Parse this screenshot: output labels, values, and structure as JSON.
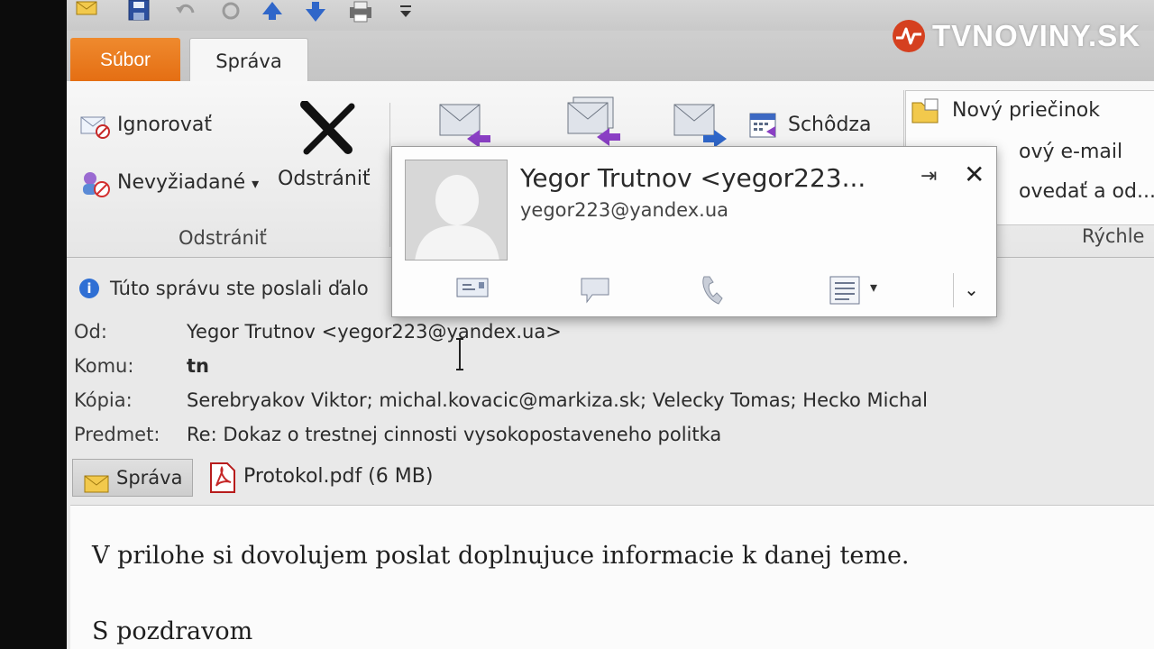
{
  "tabs": {
    "file": "Súbor",
    "message": "Správa"
  },
  "ribbon": {
    "ignore": "Ignorovať",
    "junk": "Nevyžiadané",
    "junk_arrow": "▾",
    "delete": "Odstrániť",
    "delete_group": "Odstrániť",
    "meeting": "Schôdza",
    "new_folder": "Nový priečinok",
    "new_email_partial": "ový e-mail",
    "reply_delete_partial": "ovedať a od...",
    "quick_steps_partial": "Rýchle"
  },
  "contact_card": {
    "name": "Yegor Trutnov <yegor223...",
    "email": "yegor223@yandex.ua",
    "pin": "⇥",
    "close": "✕",
    "expand": "⌄",
    "more_arrow": "▾"
  },
  "info_bar": {
    "text": "Túto správu ste poslali ďalo"
  },
  "headers": {
    "from_label": "Od:",
    "from_value": "Yegor Trutnov <yegor223@yandex.ua>",
    "to_label": "Komu:",
    "to_value": "tn",
    "cc_label": "Kópia:",
    "cc_value": "Serebryakov Viktor; michal.kovacic@markiza.sk; Velecky Tomas; Hecko Michal",
    "subject_label": "Predmet:",
    "subject_value": "Re: Dokaz o trestnej cinnosti vysokopostaveneho politka"
  },
  "attachments": {
    "message_tab": "Správa",
    "file": "Protokol.pdf (6 MB)"
  },
  "body": {
    "line1": "V prilohe si dovolujem poslat doplnujuce informacie k danej teme.",
    "line2": "S pozdravom"
  },
  "watermark": {
    "text": "TVNOVINY.SK"
  },
  "colors": {
    "file_tab": "#e46d12",
    "watermark": "#ffffff",
    "info_icon": "#2f6fd4"
  }
}
